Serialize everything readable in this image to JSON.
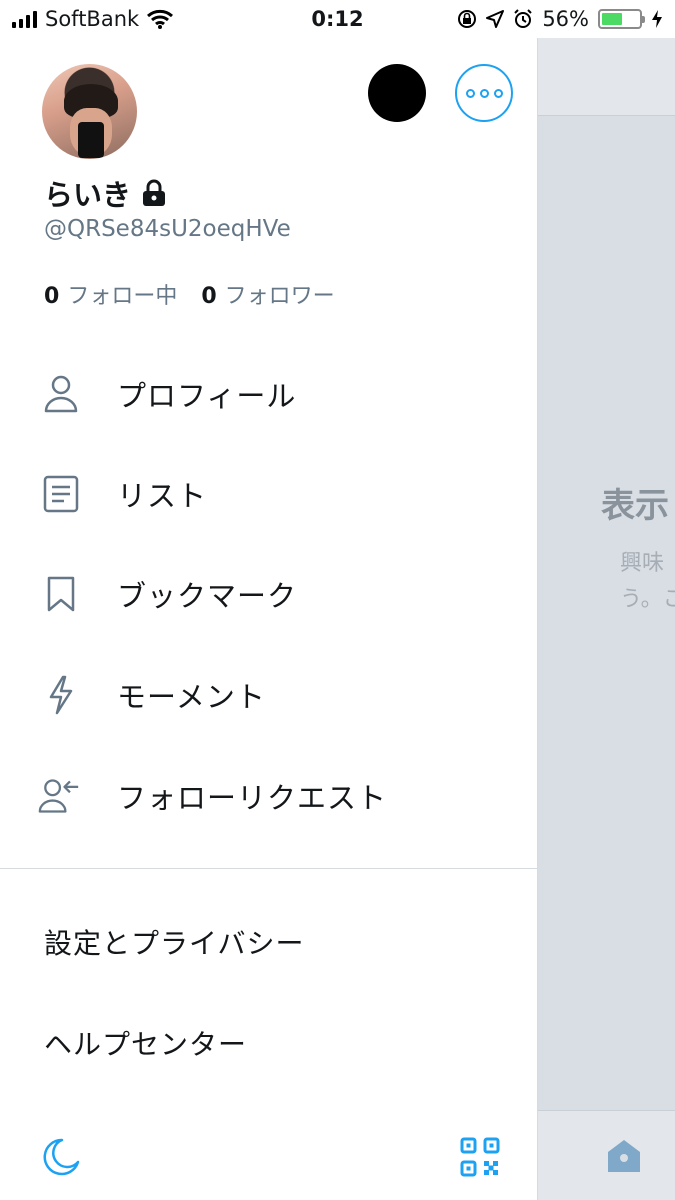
{
  "status_bar": {
    "carrier": "SoftBank",
    "time": "0:12",
    "battery_percent": "56%",
    "battery_level": 0.56,
    "icons": [
      "signal-icon",
      "wifi-icon",
      "orientation-lock-icon",
      "location-icon",
      "alarm-icon",
      "battery-icon",
      "charging-icon"
    ]
  },
  "profile": {
    "name": "らいき",
    "handle": "@QRSe84sU2oeqHVe",
    "following_count": "0",
    "following_label": "フォロー中",
    "followers_count": "0",
    "followers_label": "フォロワー"
  },
  "menu": [
    {
      "label": "プロフィール",
      "icon": "person-icon"
    },
    {
      "label": "リスト",
      "icon": "list-icon"
    },
    {
      "label": "ブックマーク",
      "icon": "bookmark-icon"
    },
    {
      "label": "モーメント",
      "icon": "lightning-icon"
    },
    {
      "label": "フォローリクエスト",
      "icon": "follow-request-icon"
    }
  ],
  "secondary": {
    "settings": "設定とプライバシー",
    "help": "ヘルプセンター"
  },
  "background": {
    "title": "表示",
    "subtitle_line1": "興味",
    "subtitle_line2": "う。こ"
  },
  "colors": {
    "accent": "#1da1f2",
    "secondary_text": "#657786",
    "overlay": "#d9dee5"
  }
}
